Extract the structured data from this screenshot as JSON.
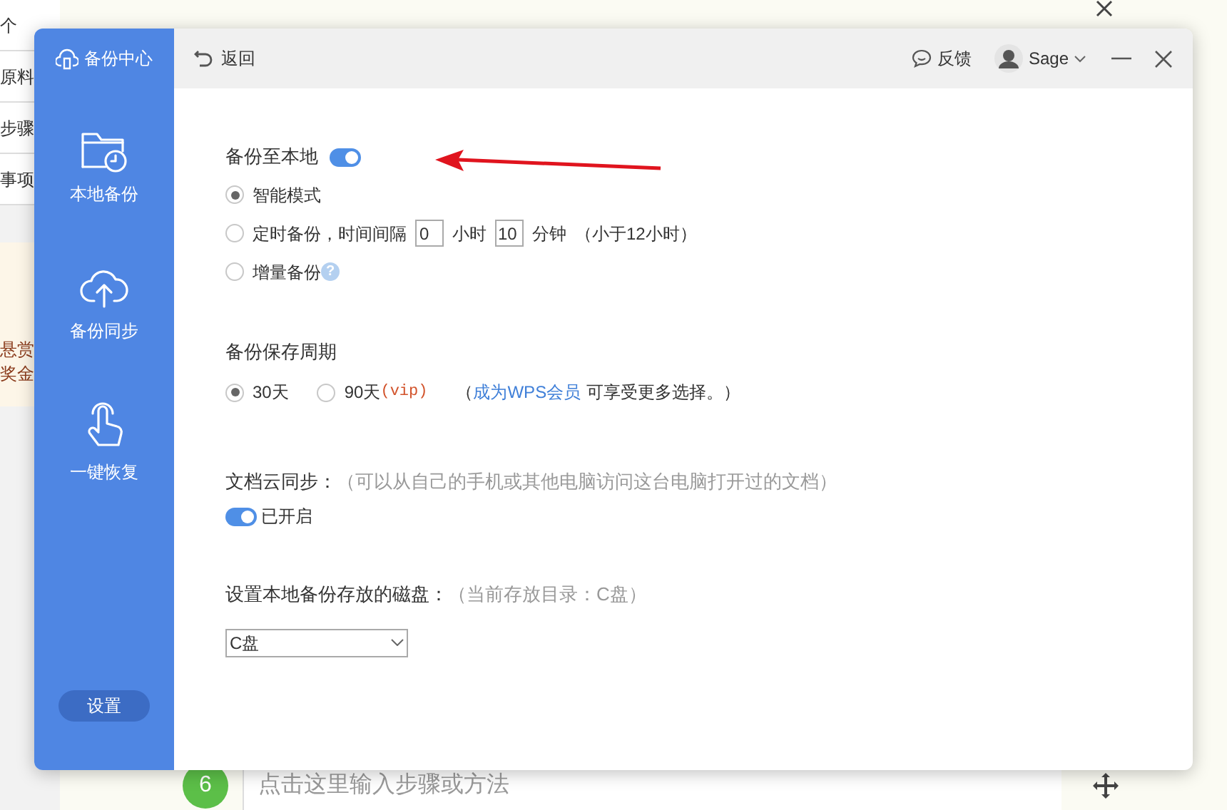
{
  "background": {
    "side_items": [
      "个",
      "原料",
      "步骤",
      "事项"
    ],
    "promo": [
      "悬赏",
      "奖金"
    ],
    "step": {
      "number": "6",
      "placeholder": "点击这里输入步骤或方法"
    }
  },
  "dialog": {
    "brand": "备份中心",
    "nav": [
      {
        "kind": "folder",
        "label": "本地备份"
      },
      {
        "kind": "cloud",
        "label": "备份同步"
      },
      {
        "kind": "hand",
        "label": "一键恢复"
      }
    ],
    "settings_button": "设置",
    "back": "返回",
    "feedback": "反馈",
    "user": "Sage",
    "local_backup": {
      "title": "备份至本地",
      "on": true,
      "modes": [
        {
          "kind": "plain",
          "label": "智能模式",
          "selected": true
        },
        {
          "kind": "timer",
          "label": "定时备份，时间间隔",
          "hours": "0",
          "hours_unit": "小时",
          "minutes": "10",
          "minutes_unit": "分钟",
          "note": "（小于12小时）",
          "selected": false
        },
        {
          "kind": "help",
          "label": "增量备份",
          "help": "?",
          "selected": false
        }
      ]
    },
    "retention": {
      "title": "备份保存周期",
      "options": [
        {
          "label": "30天",
          "selected": true
        },
        {
          "label": "90天",
          "tag": "(vip)",
          "selected": false
        }
      ],
      "note_open": "（",
      "link": "成为WPS会员",
      "note": "可享受更多选择。）"
    },
    "cloud_sync": {
      "title": "文档云同步：",
      "hint": "（可以从自己的手机或其他电脑访问这台电脑打开过的文档）",
      "on": true,
      "status": "已开启"
    },
    "disk": {
      "title": "设置本地备份存放的磁盘：",
      "hint": "（当前存放目录：C盘）",
      "value": "C盘"
    }
  }
}
